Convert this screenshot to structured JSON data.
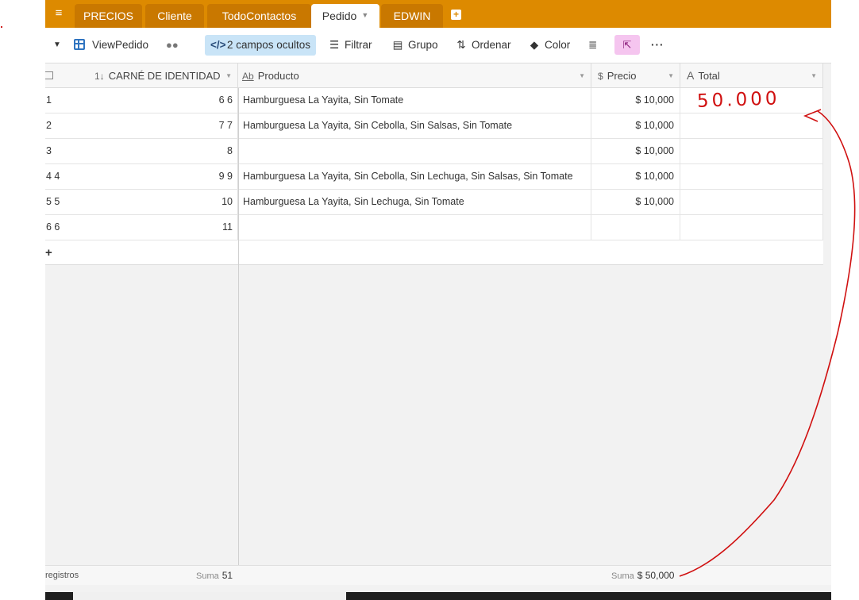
{
  "tabs": [
    {
      "label": "PRECIOS"
    },
    {
      "label": "Cliente"
    },
    {
      "label": "TodoContactos"
    },
    {
      "label": "Pedido",
      "active": true
    },
    {
      "label": "EDWIN"
    }
  ],
  "toolbar": {
    "view_name": "ViewPedido",
    "hidden_fields": "2 campos ocultos",
    "filter": "Filtrar",
    "group": "Grupo",
    "sort": "Ordenar",
    "color": "Color"
  },
  "columns": {
    "id": "CARNÉ DE IDENTIDAD",
    "product": "Producto",
    "price": "Precio",
    "total": "Total"
  },
  "rows": [
    {
      "num": "1",
      "id": "6 6",
      "product": "Hamburguesa La Yayita, Sin Tomate",
      "price": "$ 10,000"
    },
    {
      "num": "2",
      "id": "7 7",
      "product": "Hamburguesa La Yayita, Sin Cebolla, Sin Salsas, Sin Tomate",
      "price": "$ 10,000"
    },
    {
      "num": "3",
      "id": "8",
      "product": "",
      "price": "$ 10,000"
    },
    {
      "num": "4 4",
      "id": "9 9",
      "product": "Hamburguesa La Yayita, Sin Cebolla, Sin Lechuga, Sin Salsas, Sin Tomate",
      "price": "$ 10,000"
    },
    {
      "num": "5 5",
      "id": "10",
      "product": "Hamburguesa La Yayita, Sin Lechuga, Sin Tomate",
      "price": "$ 10,000"
    },
    {
      "num": "6 6",
      "id": "11",
      "product": "",
      "price": ""
    }
  ],
  "footer": {
    "records": "registros",
    "sum_label": "Suma",
    "sum_id": "51",
    "sum_price": "$ 50,000"
  },
  "annotation": {
    "text": "50.000",
    "color": "#d01010"
  },
  "colors": {
    "tabbar": "#dd8a00",
    "accent_blue": "#2f74c0",
    "hidden_fields_bg": "#c9e4f7",
    "share_bg": "#f5c5ef"
  }
}
